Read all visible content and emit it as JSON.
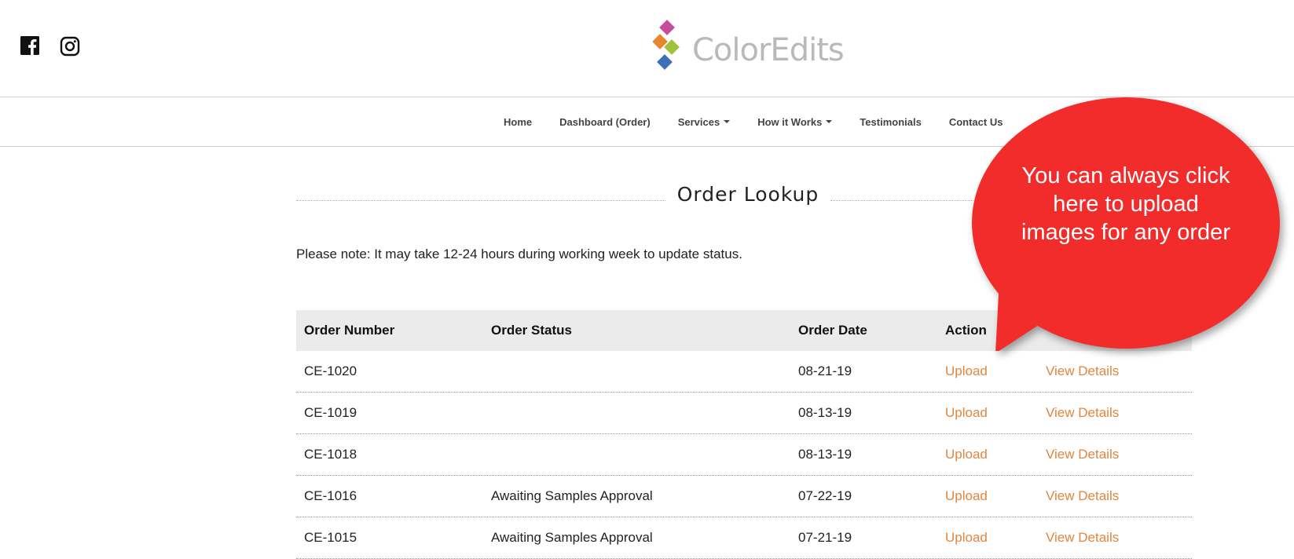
{
  "brand": {
    "logo_text": "ColorEdits",
    "logo_colors": [
      "#c64c9c",
      "#e8862e",
      "#9fc33b",
      "#3f6fb8"
    ]
  },
  "social": {
    "facebook_icon": "facebook-icon",
    "instagram_icon": "instagram-icon"
  },
  "nav": {
    "items": [
      {
        "label": "Home"
      },
      {
        "label": "Dashboard (Order)"
      },
      {
        "label": "Services"
      },
      {
        "label": "How it Works"
      },
      {
        "label": "Testimonials"
      },
      {
        "label": "Contact Us"
      }
    ]
  },
  "page": {
    "title": "Order Lookup",
    "note": "Please note: It may take 12-24 hours during working week to update status."
  },
  "table": {
    "headers": [
      "Order Number",
      "Order Status",
      "Order Date",
      "Action"
    ],
    "rows": [
      {
        "order_number": "CE-1020",
        "status": "",
        "date": "08-21-19",
        "upload": "Upload",
        "details": "View Details"
      },
      {
        "order_number": "CE-1019",
        "status": "",
        "date": "08-13-19",
        "upload": "Upload",
        "details": "View Details"
      },
      {
        "order_number": "CE-1018",
        "status": "",
        "date": "08-13-19",
        "upload": "Upload",
        "details": "View Details"
      },
      {
        "order_number": "CE-1016",
        "status": "Awaiting Samples Approval",
        "date": "07-22-19",
        "upload": "Upload",
        "details": "View Details"
      },
      {
        "order_number": "CE-1015",
        "status": "Awaiting Samples Approval",
        "date": "07-21-19",
        "upload": "Upload",
        "details": "View Details"
      }
    ]
  },
  "callout": {
    "text": "You can always click here to upload images for any order",
    "color": "#f22b2b"
  },
  "colors": {
    "link": "#e0863e",
    "header_bg": "#ebebeb"
  }
}
